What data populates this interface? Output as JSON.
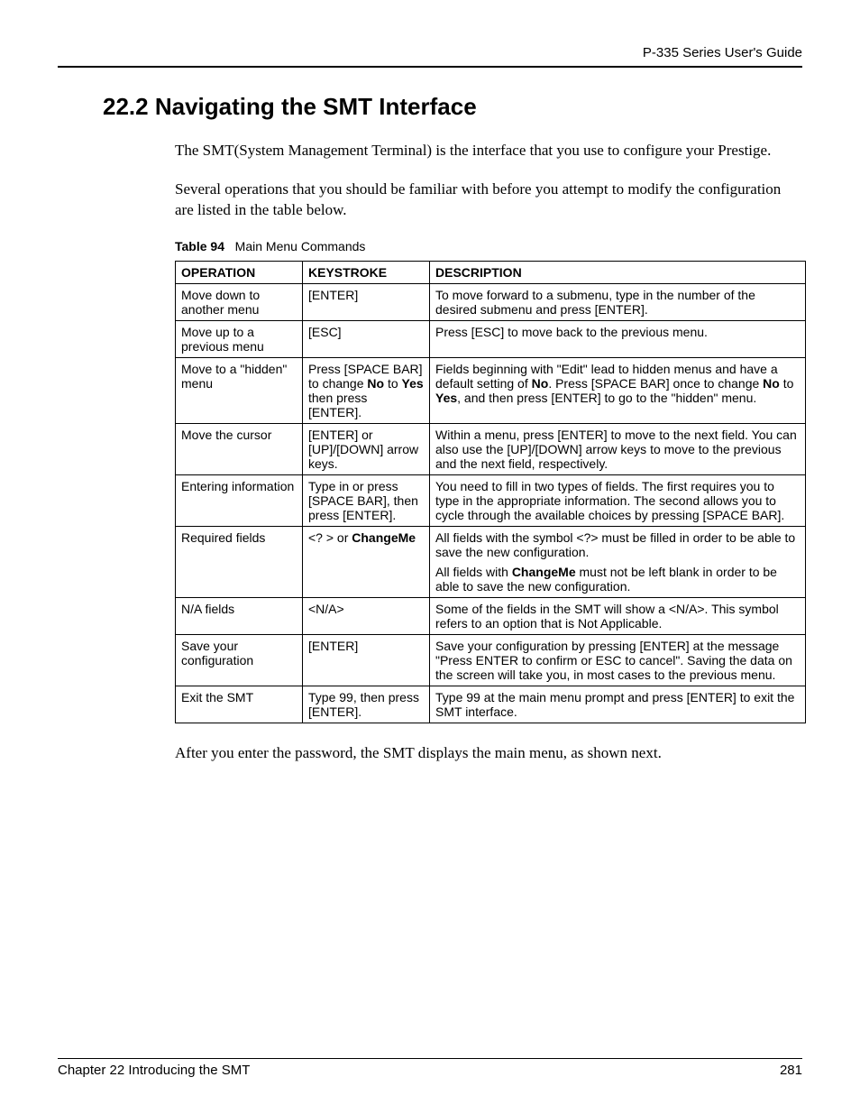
{
  "header": {
    "guide_title": "P-335 Series User's Guide"
  },
  "section": {
    "number_title": "22.2  Navigating the SMT Interface",
    "para1": "The SMT(System Management Terminal) is the interface that you use to configure your Prestige.",
    "para2": "Several operations that you should be familiar with before you attempt to modify the configuration are listed in the table below.",
    "after_table": "After you enter the password, the SMT displays the main menu, as shown next."
  },
  "table": {
    "label": "Table 94",
    "title": "Main Menu Commands",
    "head": {
      "operation": "OPERATION",
      "keystroke": "KEYSTROKE",
      "description": "DESCRIPTION"
    },
    "rows": [
      {
        "operation": "Move down to another menu",
        "keystroke": "[ENTER]",
        "description_html": "To move forward to a submenu, type in the number of the desired submenu and press [ENTER]."
      },
      {
        "operation": "Move up to a previous menu",
        "keystroke": "[ESC]",
        "description_html": "Press [ESC] to move back to the previous menu."
      },
      {
        "operation": "Move to a \"hidden\" menu",
        "keystroke_html": "Press [SPACE BAR] to change <b>No</b> to <b>Yes</b> then press [ENTER].",
        "description_html": "Fields beginning with \"Edit\" lead to hidden menus and have a default setting of <b>No</b>. Press [SPACE BAR] once to change <b>No</b> to <b>Yes</b>, and then press [ENTER] to go to the  \"hidden\" menu."
      },
      {
        "operation": "Move the cursor",
        "keystroke": "[ENTER] or [UP]/[DOWN] arrow keys.",
        "description_html": "Within a menu, press [ENTER] to move to the next field. You can also use the [UP]/[DOWN] arrow keys to move to the previous and the next field, respectively."
      },
      {
        "operation": "Entering information",
        "keystroke": "Type in or press [SPACE BAR], then press [ENTER].",
        "description_html": "You need to fill in two types of fields. The first requires you to type in the appropriate information. The second allows you to cycle through the available choices by pressing [SPACE BAR]."
      },
      {
        "operation": "Required fields",
        "keystroke_html": "&lt;? &gt; or <b>ChangeMe</b>",
        "description_html": "<div class=\"desc-block\">All fields with the symbol &lt;?&gt; must be filled in order to be able to save the new configuration.</div><div class=\"desc-block\">All fields with <b>ChangeMe</b> must not be left blank in order to be able to save the new configuration.</div>"
      },
      {
        "operation": "N/A fields",
        "keystroke": "<N/A>",
        "description_html": "Some of the fields in the SMT will show a &lt;N/A&gt;. This symbol refers to an option that is Not Applicable."
      },
      {
        "operation": "Save your configuration",
        "keystroke": "[ENTER]",
        "description_html": "Save your configuration by pressing [ENTER] at the message \"Press ENTER to confirm or ESC to cancel\". Saving the data on the screen will take you, in most cases to the previous menu."
      },
      {
        "operation": "Exit the SMT",
        "keystroke": "Type 99, then press [ENTER].",
        "description_html": "Type 99 at the main menu prompt and press [ENTER] to exit the SMT interface."
      }
    ]
  },
  "footer": {
    "chapter": "Chapter 22 Introducing the SMT",
    "page": "281"
  }
}
